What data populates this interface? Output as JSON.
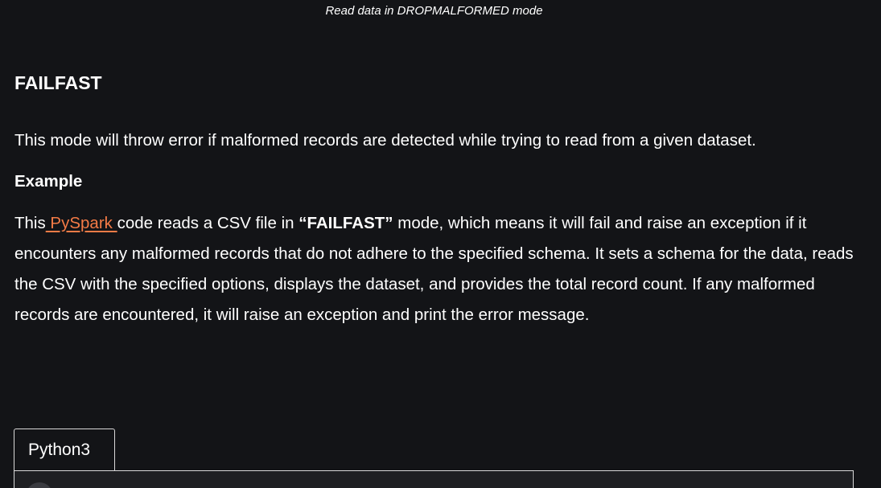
{
  "figure": {
    "caption": "Read data in DROPMALFORMED mode"
  },
  "section": {
    "heading": "FAILFAST",
    "intro": "This mode will throw error if malformed records are detected while trying to read from a given dataset.",
    "example_heading": "Example",
    "example_text": {
      "before_link": "This",
      "link_text": " PySpark ",
      "after_link": "code reads a CSV file in ",
      "bold_term": "“FAILFAST”",
      "rest": " mode, which means it will fail and raise an exception if it encounters any malformed records that do not adhere to the specified schema. It sets a schema for the data, reads the CSV with the specified options, displays the dataset, and provides the total record count. If any malformed records are encountered, it will raise an exception and print the error message."
    }
  },
  "code_block": {
    "tab_label": "Python3"
  },
  "colors": {
    "background": "#131417",
    "text": "#ffffff",
    "link": "#f47b46",
    "tab_border": "#d9d9d9"
  }
}
